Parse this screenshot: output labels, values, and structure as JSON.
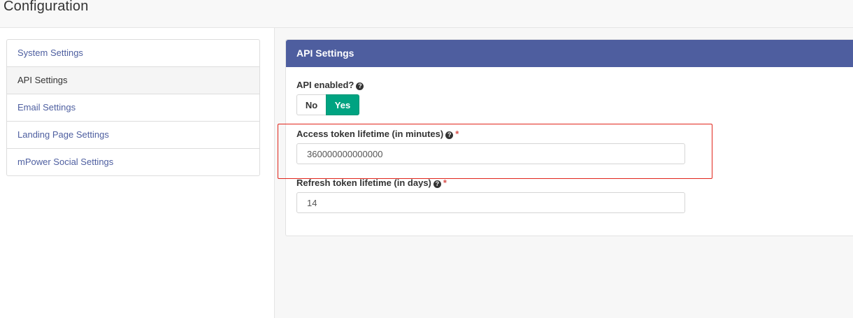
{
  "page": {
    "title": "Configuration"
  },
  "sidebar": {
    "items": [
      {
        "label": "System Settings"
      },
      {
        "label": "API Settings",
        "active": true
      },
      {
        "label": "Email Settings"
      },
      {
        "label": "Landing Page Settings"
      },
      {
        "label": "mPower Social Settings"
      }
    ]
  },
  "panel": {
    "title": "API Settings",
    "api_enabled": {
      "label": "API enabled?",
      "help_icon": "question-circle-icon",
      "options": [
        "No",
        "Yes"
      ],
      "selected": "Yes"
    },
    "access_token": {
      "label": "Access token lifetime (in minutes)",
      "help_icon": "question-circle-icon",
      "required_mark": "*",
      "value": "360000000000000"
    },
    "refresh_token": {
      "label": "Refresh token lifetime (in days)",
      "help_icon": "question-circle-icon",
      "required_mark": "*",
      "value": "14"
    }
  },
  "colors": {
    "panel_header": "#4e5e9f",
    "toggle_active": "#00a381",
    "link": "#4e5fa0",
    "required": "#d9534f",
    "highlight": "#e1251b"
  }
}
